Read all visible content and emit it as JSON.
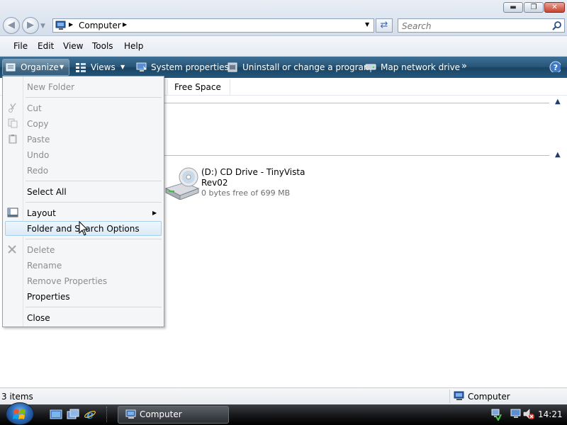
{
  "window": {
    "controls": [
      "minimize-icon",
      "maximize-icon",
      "close-icon"
    ],
    "address": {
      "icon": "computer-icon",
      "path": [
        "Computer"
      ]
    },
    "search": {
      "placeholder": "Search"
    }
  },
  "menubar": {
    "items": [
      "File",
      "Edit",
      "View",
      "Tools",
      "Help"
    ]
  },
  "commandbar": {
    "organize": "Organize",
    "views": "Views",
    "system_properties": "System properties",
    "uninstall": "Uninstall or change a program",
    "map_drive": "Map network drive",
    "more": "»",
    "help_icon": "help-icon"
  },
  "content": {
    "column_headers": [
      "Free Space"
    ],
    "drive": {
      "name": "(D:) CD Drive - TinyVista",
      "label_line2": "Rev02",
      "free": "0 bytes free of 699 MB",
      "icon": "cd-drive-icon"
    }
  },
  "organize_menu": {
    "items": [
      {
        "label": "New Folder",
        "enabled": false
      },
      {
        "label": "Cut",
        "enabled": false,
        "icon": "scissors-icon"
      },
      {
        "label": "Copy",
        "enabled": false,
        "icon": "copy-icon"
      },
      {
        "label": "Paste",
        "enabled": false,
        "icon": "paste-icon"
      },
      {
        "label": "Undo",
        "enabled": false
      },
      {
        "label": "Redo",
        "enabled": false
      },
      {
        "label": "Select All",
        "enabled": true
      },
      {
        "label": "Layout",
        "enabled": true,
        "icon": "layout-icon",
        "submenu": true
      },
      {
        "label": "Folder and Search Options",
        "enabled": true,
        "highlighted": true
      },
      {
        "label": "Delete",
        "enabled": false,
        "icon": "delete-x-icon"
      },
      {
        "label": "Rename",
        "enabled": false
      },
      {
        "label": "Remove Properties",
        "enabled": false
      },
      {
        "label": "Properties",
        "enabled": true
      },
      {
        "label": "Close",
        "enabled": true
      }
    ]
  },
  "statusbar": {
    "count": "3 items",
    "location": "Computer"
  },
  "taskbar": {
    "start_icon": "windows-start-orb",
    "quicklaunch": [
      "show-desktop-icon",
      "switch-windows-icon",
      "internet-explorer-icon"
    ],
    "active_window": "Computer",
    "clock": "14:21",
    "tray": [
      "network-icon",
      "volume-muted-icon"
    ]
  },
  "colors": {
    "command_bar": "#24587d",
    "menu_highlight": "#dbeaf7",
    "group_line": "#a9c0dc"
  }
}
